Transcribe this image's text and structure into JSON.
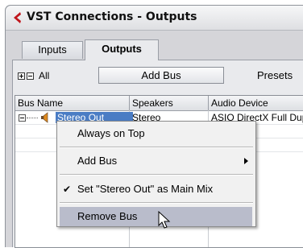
{
  "window": {
    "title": "VST Connections - Outputs"
  },
  "tabs": [
    {
      "label": "Inputs",
      "active": false
    },
    {
      "label": "Outputs",
      "active": true
    }
  ],
  "toolbar": {
    "all_label": "All",
    "add_bus_label": "Add Bus",
    "presets_label": "Presets"
  },
  "table": {
    "columns": [
      "Bus Name",
      "Speakers",
      "Audio Device"
    ],
    "rows": [
      {
        "bus_name": "Stereo Out",
        "speakers": "Stereo",
        "audio_device": "ASIO DirectX Full Duplex"
      }
    ]
  },
  "context_menu": {
    "items": [
      {
        "label": "Always on Top",
        "submenu": false,
        "checked": false,
        "highlighted": false
      },
      {
        "label": "Add Bus",
        "submenu": true,
        "checked": false,
        "highlighted": false
      },
      {
        "label": "Set \"Stereo Out\" as Main Mix",
        "submenu": false,
        "checked": true,
        "highlighted": false
      },
      {
        "label": "Remove Bus",
        "submenu": false,
        "checked": false,
        "highlighted": true
      }
    ]
  },
  "icons": {
    "app": "cubase-logo-icon",
    "expand_all": "plus-box-icon",
    "collapse_all": "minus-box-icon",
    "tree_toggle": "minus-box-icon",
    "speaker": "speaker-icon",
    "submenu": "chevron-right-icon",
    "check": "checkmark-icon",
    "cursor": "mouse-pointer-icon"
  },
  "colors": {
    "selection": "#4a7cc4",
    "menu_highlight": "#b9bccb",
    "app_icon": "#c0161c"
  }
}
